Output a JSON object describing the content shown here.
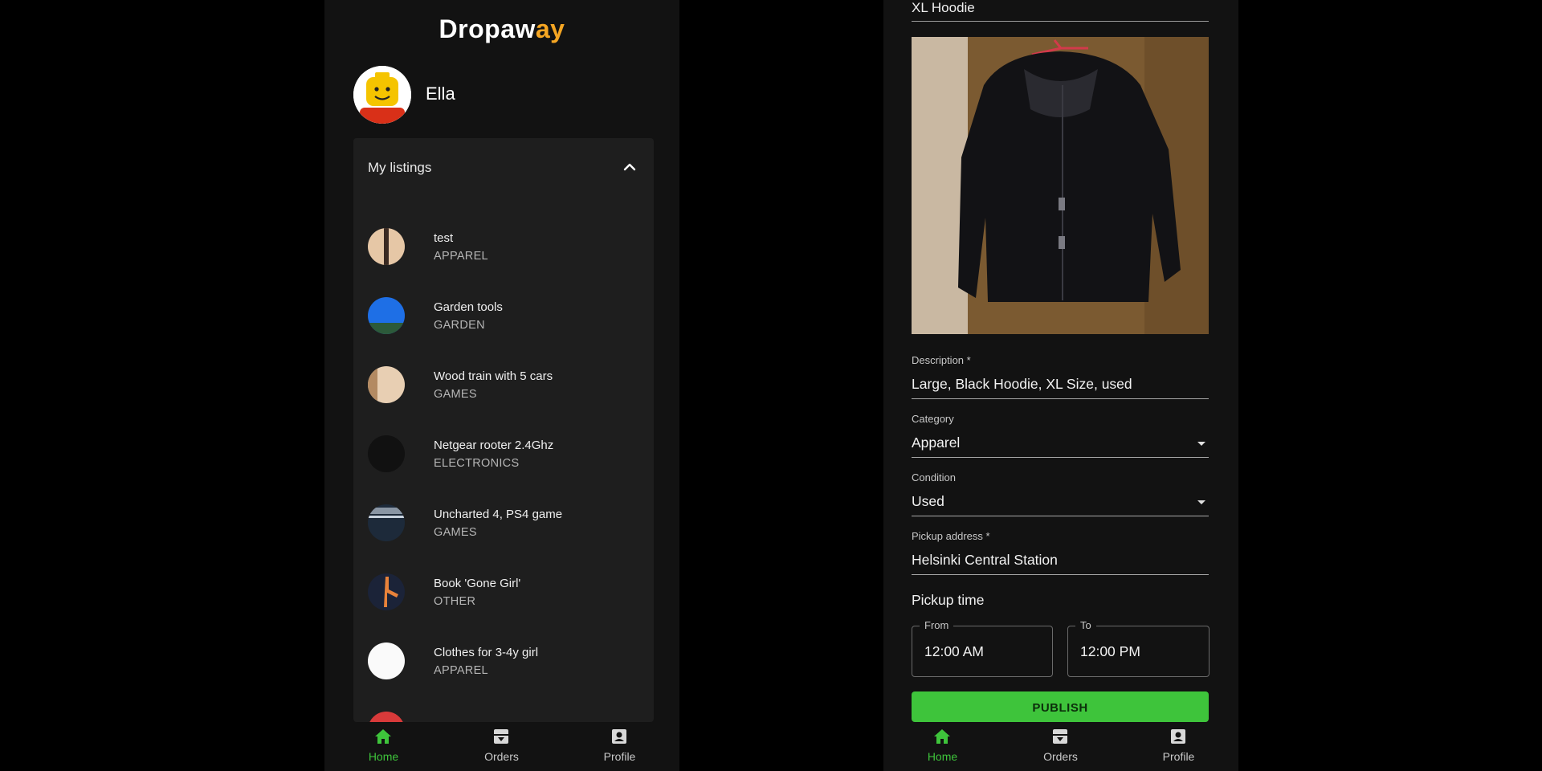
{
  "left": {
    "logo": {
      "part1": "Dropaw",
      "part2": "ay"
    },
    "user": {
      "name": "Ella"
    },
    "listings_panel": {
      "title": "My listings"
    },
    "listings": [
      {
        "title": "test",
        "category": "APPAREL"
      },
      {
        "title": "Garden tools",
        "category": "GARDEN"
      },
      {
        "title": "Wood train with 5 cars",
        "category": "GAMES"
      },
      {
        "title": "Netgear rooter 2.4Ghz",
        "category": "ELECTRONICS"
      },
      {
        "title": "Uncharted 4, PS4 game",
        "category": "GAMES"
      },
      {
        "title": "Book 'Gone Girl'",
        "category": "OTHER"
      },
      {
        "title": "Clothes for 3-4y girl",
        "category": "APPAREL"
      }
    ],
    "nav": {
      "home": "Home",
      "orders": "Orders",
      "profile": "Profile"
    }
  },
  "right": {
    "title_value": "XL Hoodie",
    "description": {
      "label": "Description *",
      "value": "Large, Black Hoodie, XL Size, used"
    },
    "category": {
      "label": "Category",
      "value": "Apparel"
    },
    "condition": {
      "label": "Condition",
      "value": "Used"
    },
    "pickup_address": {
      "label": "Pickup address *",
      "value": "Helsinki Central Station"
    },
    "pickup_time": {
      "title": "Pickup time",
      "from": {
        "label": "From",
        "value": "12:00 AM"
      },
      "to": {
        "label": "To",
        "value": "12:00 PM"
      }
    },
    "publish_label": "PUBLISH",
    "nav": {
      "home": "Home",
      "orders": "Orders",
      "profile": "Profile"
    }
  },
  "colors": {
    "accent": "#3ec43b",
    "background": "#121212",
    "panel": "#1e1e1e",
    "logo_accent": "#f5a623"
  },
  "icons": [
    "home-icon",
    "orders-icon",
    "profile-icon",
    "chevron-up-icon",
    "dropdown-arrow-icon"
  ]
}
